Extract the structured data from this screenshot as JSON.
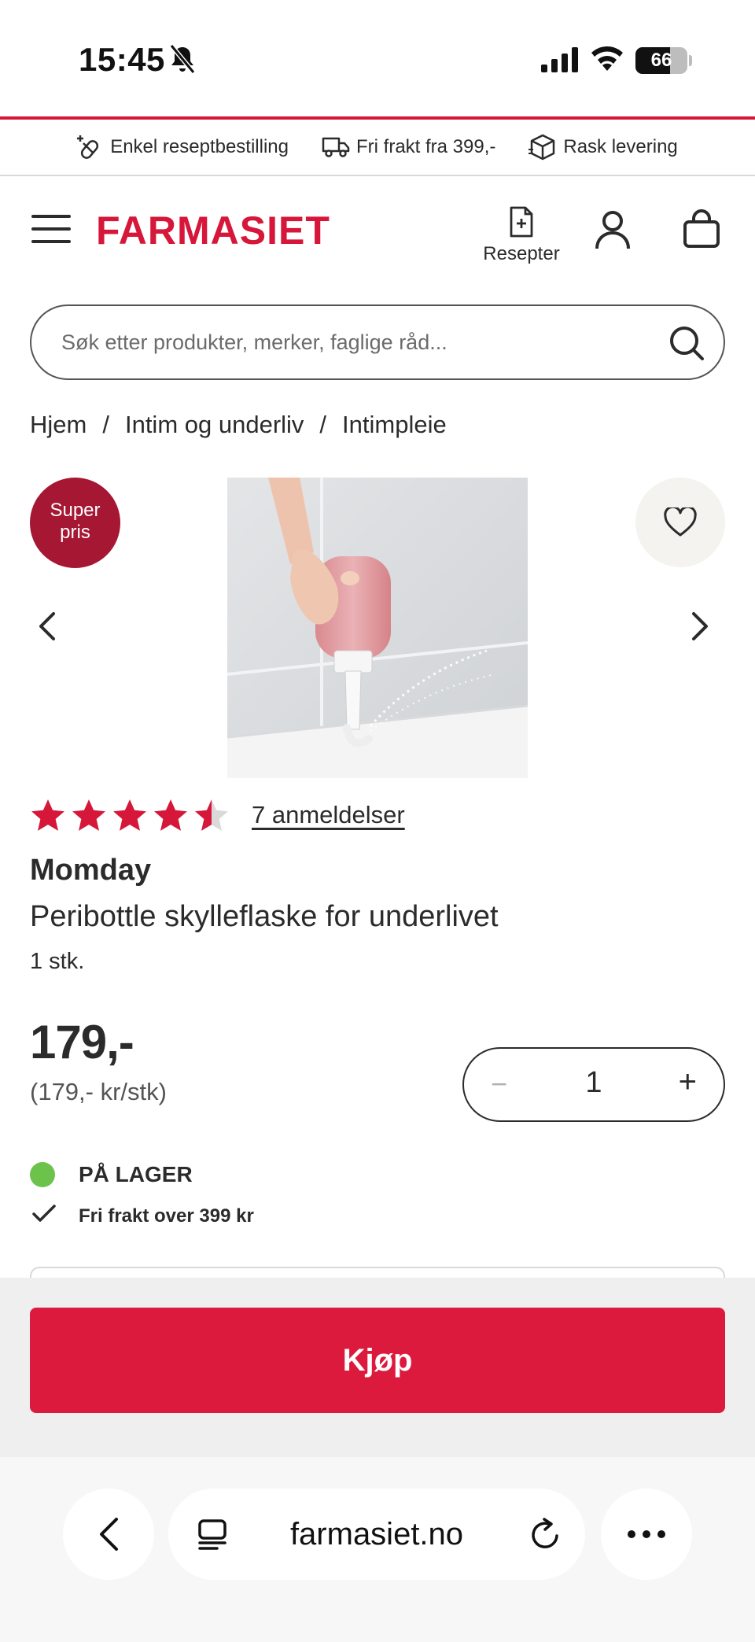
{
  "status_bar": {
    "time": "15:45",
    "battery": "66"
  },
  "usp_bar": {
    "items": [
      {
        "label": "Enkel reseptbestilling",
        "icon": "pill-plus-icon"
      },
      {
        "label": "Fri frakt fra 399,-",
        "icon": "truck-icon"
      },
      {
        "label": "Rask levering",
        "icon": "package-icon"
      }
    ]
  },
  "header": {
    "logo": "FARMASIET",
    "prescriptions_label": "Resepter"
  },
  "search": {
    "placeholder": "Søk etter produkter, merker, faglige råd..."
  },
  "breadcrumb": [
    "Hjem",
    "Intim og underliv",
    "Intimpleie"
  ],
  "product": {
    "badge_line1": "Super",
    "badge_line2": "pris",
    "rating": 4.5,
    "rating_max": 5,
    "reviews_label": "7 anmeldelser",
    "brand": "Momday",
    "name": "Peribottle skylleflaske for underlivet",
    "pack_size": "1 stk.",
    "price": "179,-",
    "unit_price": "(179,- kr/stk)",
    "quantity": "1",
    "stock_status": "PÅ LAGER",
    "shipping_note": "Fri frakt over 399 kr"
  },
  "buy_button_label": "Kjøp",
  "browser": {
    "url": "farmasiet.no"
  },
  "colors": {
    "brand": "#d6173a",
    "badge": "#a51733",
    "stock": "#6cc24a",
    "buy": "#dc1a3d"
  }
}
